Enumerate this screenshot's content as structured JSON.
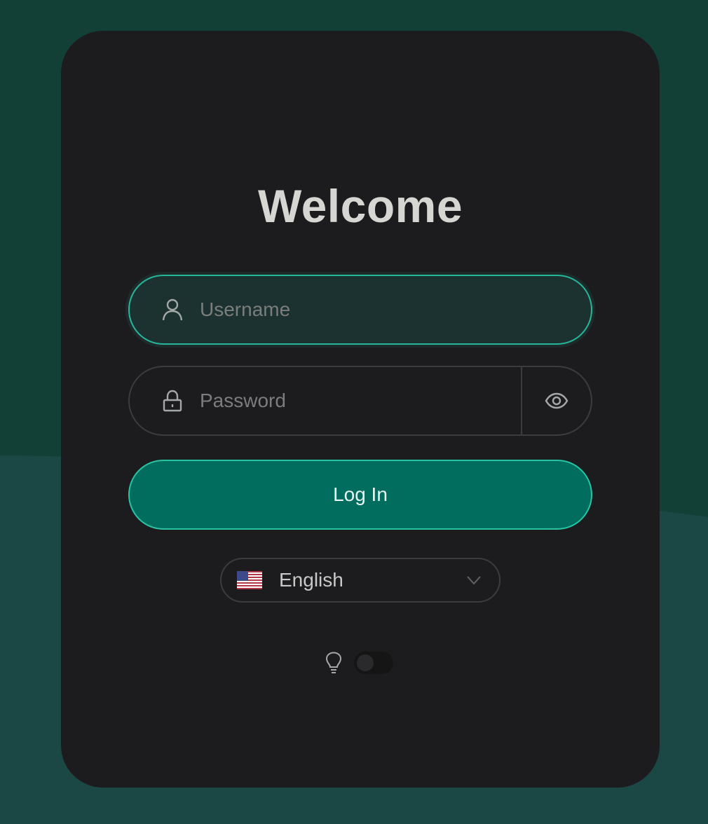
{
  "colors": {
    "background_top": "#124036",
    "background_bottom": "#1b4844",
    "card": "#1c1c1e",
    "accent": "#27b69b",
    "button": "#006d5e"
  },
  "login": {
    "title": "Welcome",
    "username": {
      "placeholder": "Username",
      "value": "",
      "icon": "user-icon"
    },
    "password": {
      "placeholder": "Password",
      "value": "",
      "icon": "lock-icon",
      "toggle_icon": "eye-icon"
    },
    "submit_label": "Log In"
  },
  "language": {
    "flag": "🇺🇸",
    "selected": "English",
    "icon": "chevron-down-icon"
  },
  "theme": {
    "icon": "lightbulb-icon",
    "toggle_on": false
  }
}
